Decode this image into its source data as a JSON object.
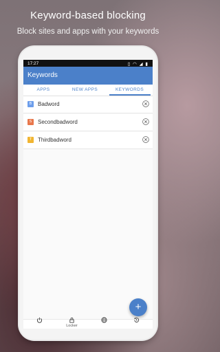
{
  "promo": {
    "title": "Keyword-based blocking",
    "subtitle": "Block sites and apps with your keywords"
  },
  "status_bar": {
    "time": "17:27",
    "icons": [
      "sync-icon",
      "vibrate-icon",
      "wifi-icon",
      "signal-icon",
      "battery-icon"
    ]
  },
  "app_bar": {
    "title": "Keywords",
    "color": "#4b80c9"
  },
  "tabs": [
    {
      "label": "APPS",
      "selected": false
    },
    {
      "label": "NEW APPS",
      "selected": false
    },
    {
      "label": "KEYWORDS",
      "selected": true
    }
  ],
  "keywords": [
    {
      "letter": "B",
      "word": "Badword",
      "color": "#6d9eeb"
    },
    {
      "letter": "S",
      "word": "Secondbadword",
      "color": "#e8774b"
    },
    {
      "letter": "T",
      "word": "Thirdbadword",
      "color": "#f1b531"
    }
  ],
  "fab": {
    "symbol": "+"
  },
  "bottom_nav": [
    {
      "icon": "power-icon",
      "label": ""
    },
    {
      "icon": "lock-icon",
      "label": "Locker"
    },
    {
      "icon": "globe-icon",
      "label": ""
    },
    {
      "icon": "history-icon",
      "label": ""
    }
  ]
}
